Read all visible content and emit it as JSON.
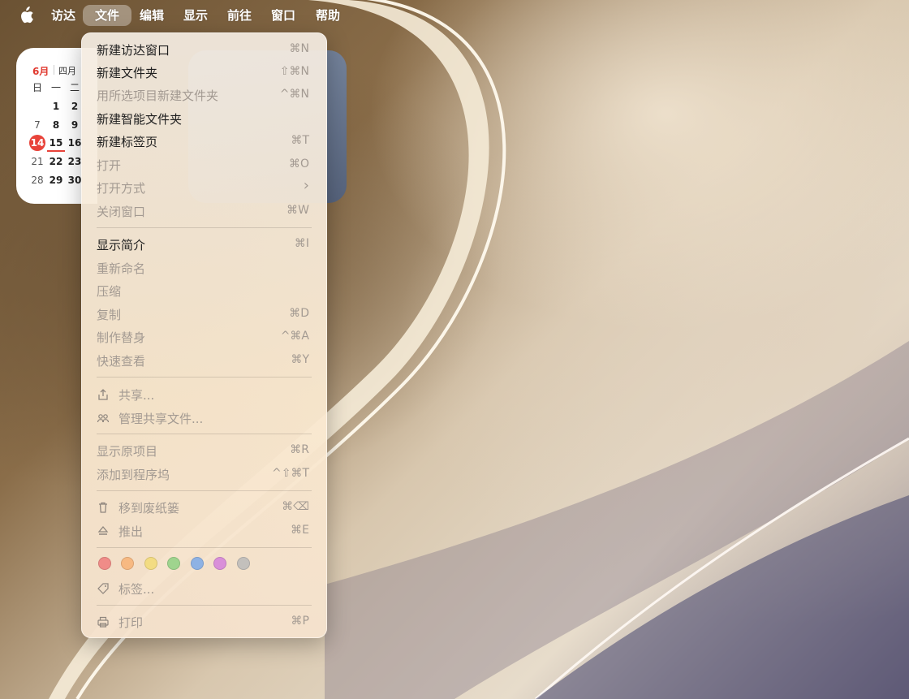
{
  "menubar": {
    "items": [
      "访达",
      "文件",
      "编辑",
      "显示",
      "前往",
      "窗口",
      "帮助"
    ],
    "active": "文件"
  },
  "calendar_widget": {
    "month": "6月",
    "lunar": "四月",
    "weekday_headers": [
      "日",
      "一",
      "二"
    ],
    "rows": [
      [
        "",
        "1",
        "2"
      ],
      [
        "7",
        "8",
        "9"
      ],
      [
        "14",
        "15",
        "16"
      ],
      [
        "21",
        "22",
        "23"
      ],
      [
        "28",
        "29",
        "30"
      ]
    ],
    "today": "14"
  },
  "file_menu": {
    "items": [
      {
        "label": "新建访达窗口",
        "shortcut": "⌘N",
        "enabled": true
      },
      {
        "label": "新建文件夹",
        "shortcut": "⇧⌘N",
        "enabled": true
      },
      {
        "label": "用所选项目新建文件夹",
        "shortcut": "^⌘N",
        "enabled": false
      },
      {
        "label": "新建智能文件夹",
        "shortcut": "",
        "enabled": true
      },
      {
        "label": "新建标签页",
        "shortcut": "⌘T",
        "enabled": true
      },
      {
        "label": "打开",
        "shortcut": "⌘O",
        "enabled": false
      },
      {
        "label": "打开方式",
        "shortcut": "›",
        "enabled": false
      },
      {
        "label": "关闭窗口",
        "shortcut": "⌘W",
        "enabled": false
      },
      {
        "label": "显示简介",
        "shortcut": "⌘I",
        "enabled": true
      },
      {
        "label": "重新命名",
        "shortcut": "",
        "enabled": false
      },
      {
        "label": "压缩",
        "shortcut": "",
        "enabled": false
      },
      {
        "label": "复制",
        "shortcut": "⌘D",
        "enabled": false
      },
      {
        "label": "制作替身",
        "shortcut": "^⌘A",
        "enabled": false
      },
      {
        "label": "快速查看",
        "shortcut": "⌘Y",
        "enabled": false
      },
      {
        "label": "共享...",
        "shortcut": "",
        "enabled": false,
        "icon": "share-icon"
      },
      {
        "label": "管理共享文件...",
        "shortcut": "",
        "enabled": false,
        "icon": "people-icon"
      },
      {
        "label": "显示原项目",
        "shortcut": "⌘R",
        "enabled": false
      },
      {
        "label": "添加到程序坞",
        "shortcut": "^⇧⌘T",
        "enabled": false
      },
      {
        "label": "移到废纸篓",
        "shortcut": "⌘⌫",
        "enabled": false,
        "icon": "trash-icon"
      },
      {
        "label": "推出",
        "shortcut": "⌘E",
        "enabled": false,
        "icon": "eject-icon"
      },
      {
        "label": "标签...",
        "shortcut": "",
        "enabled": false,
        "icon": "tag-icon"
      },
      {
        "label": "打印",
        "shortcut": "⌘P",
        "enabled": false,
        "icon": "printer-icon"
      }
    ],
    "tag_colors": [
      {
        "name": "red",
        "color": "#f08c88"
      },
      {
        "name": "orange",
        "color": "#f7b982"
      },
      {
        "name": "yellow",
        "color": "#f3dc82"
      },
      {
        "name": "green",
        "color": "#9fd48e"
      },
      {
        "name": "blue",
        "color": "#8eb2e4"
      },
      {
        "name": "purple",
        "color": "#d98fd9"
      },
      {
        "name": "gray",
        "color": "#c3c0bc"
      }
    ]
  }
}
